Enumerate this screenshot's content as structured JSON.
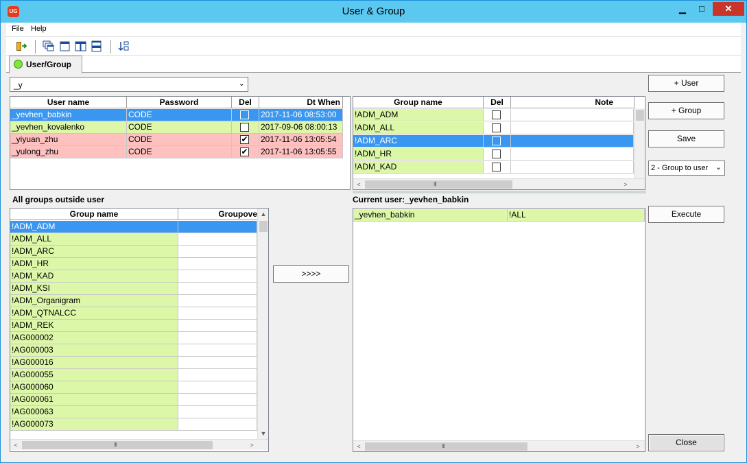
{
  "window": {
    "title": "User & Group",
    "app_icon": "UG",
    "minimize": "▁",
    "maximize": "□",
    "close": "✕"
  },
  "menu": {
    "items": [
      "File",
      "Help"
    ]
  },
  "toolbar": {
    "icons": [
      "exit-icon",
      "cascade-windows-icon",
      "single-window-icon",
      "tile-vertical-icon",
      "tile-horizontal-icon",
      "sort-icon"
    ]
  },
  "tab": {
    "label": "User/Group"
  },
  "filter": {
    "value": "_y"
  },
  "users": {
    "columns": [
      "User name",
      "Password",
      "Del",
      "Dt When"
    ],
    "rows": [
      {
        "name": "_yevhen_babkin",
        "password": "CODE",
        "del": false,
        "dt": "2017-11-06 08:53:00",
        "state": "selected"
      },
      {
        "name": "_yevhen_kovalenko",
        "password": "CODE",
        "del": false,
        "dt": "2017-09-06 08:00:13",
        "state": "green"
      },
      {
        "name": "_yiyuan_zhu",
        "password": "CODE",
        "del": true,
        "dt": "2017-11-06 13:05:54",
        "state": "pink"
      },
      {
        "name": "_yulong_zhu",
        "password": "CODE",
        "del": true,
        "dt": "2017-11-06 13:05:55",
        "state": "pink"
      }
    ]
  },
  "groups": {
    "columns": [
      "Group name",
      "Del",
      "Note"
    ],
    "rows": [
      {
        "name": "!ADM_ADM",
        "del": false,
        "state": "green"
      },
      {
        "name": "!ADM_ALL",
        "del": false,
        "state": "green"
      },
      {
        "name": "!ADM_ARC",
        "del": false,
        "state": "selected"
      },
      {
        "name": "!ADM_HR",
        "del": false,
        "state": "green"
      },
      {
        "name": "!ADM_KAD",
        "del": false,
        "state": "green"
      }
    ]
  },
  "outside": {
    "title": "All groups outside user",
    "columns": [
      "Group name",
      "Groupove"
    ],
    "rows": [
      "!ADM_ADM",
      "!ADM_ALL",
      "!ADM_ARC",
      "!ADM_HR",
      "!ADM_KAD",
      "!ADM_KSI",
      "!ADM_Organigram",
      "!ADM_QTNALCC",
      "!ADM_REK",
      "!AG000002",
      "!AG000003",
      "!AG000016",
      "!AG000055",
      "!AG000060",
      "!AG000061",
      "!AG000063",
      "!AG000073"
    ]
  },
  "current": {
    "title": "Current user:_yevhen_babkin",
    "rows": [
      {
        "user": "_yevhen_babkin",
        "group": "!ALL"
      }
    ]
  },
  "buttons": {
    "add_user": "+ User",
    "add_group": "+ Group",
    "save": "Save",
    "mode": "2 - Group to user",
    "execute": "Execute",
    "move": ">>>>",
    "close": "Close"
  },
  "scroll": {
    "grip": "III",
    "up": "▲",
    "down": "▼",
    "left": "<",
    "right": ">"
  },
  "colors": {
    "title_bar": "#5bc8f0",
    "selected_row": "#3a97f1",
    "green_row": "#ddf7a9",
    "pink_row": "#ffc0c0",
    "close_button": "#c9352b"
  }
}
